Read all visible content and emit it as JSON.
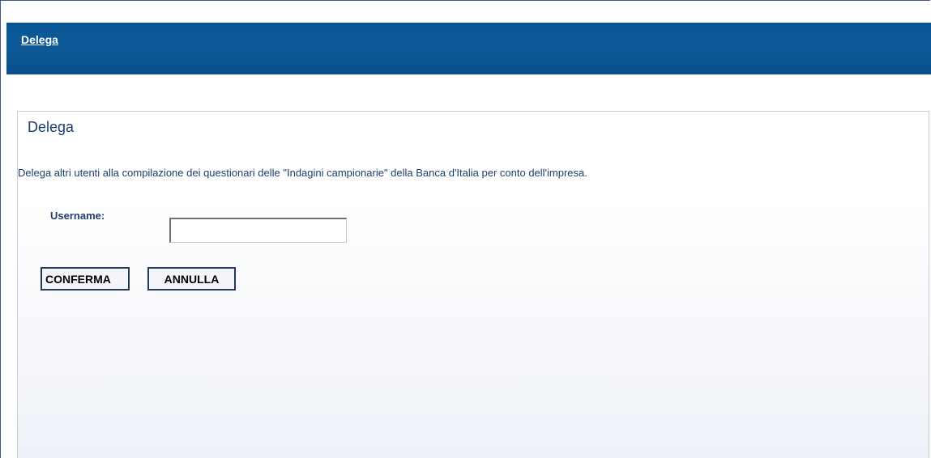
{
  "header": {
    "link_label": "Delega"
  },
  "panel": {
    "title": "Delega",
    "description": "Delega altri utenti alla compilazione dei questionari delle \"Indagini campionarie\" della Banca d'Italia per conto dell'impresa.",
    "username_label": "Username:",
    "username_value": "",
    "confirm_label": "CONFERMA",
    "cancel_label": "ANNULLA"
  }
}
